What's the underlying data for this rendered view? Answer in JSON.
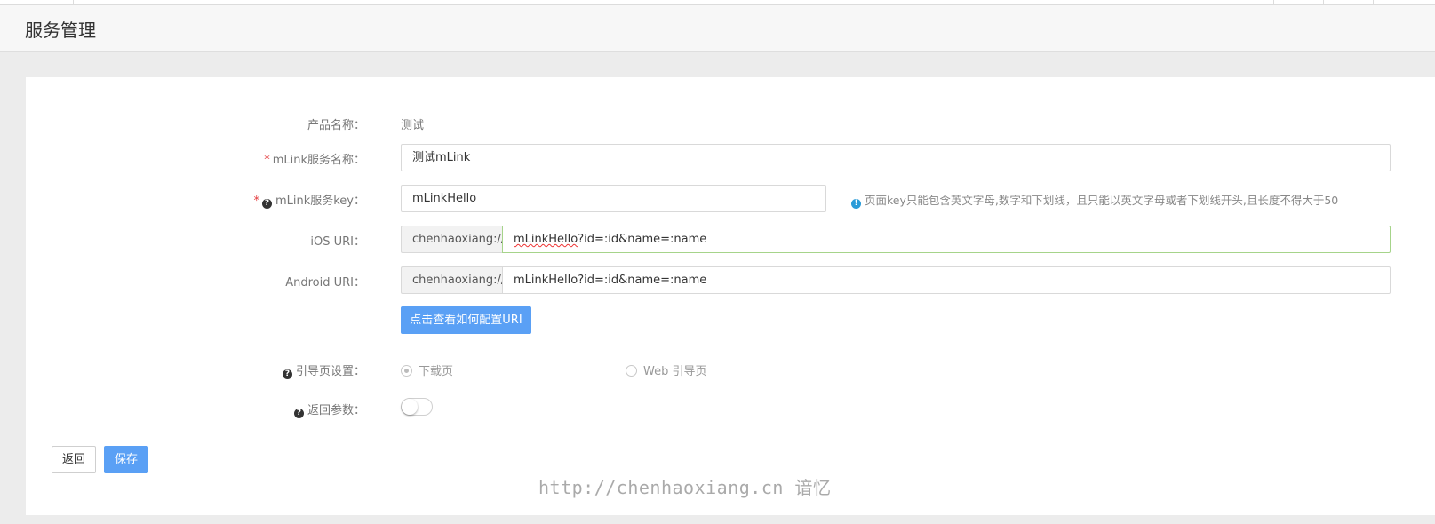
{
  "page": {
    "title": "服务管理"
  },
  "form": {
    "product_name": {
      "label": "产品名称：",
      "value": "测试"
    },
    "mlink_name": {
      "label": "mLink服务名称：",
      "required": "*",
      "value": "测试mLink"
    },
    "mlink_key": {
      "label": "mLink服务key：",
      "required": "*",
      "value": "mLinkHello",
      "hint": "页面key只能包含英文字母,数字和下划线，且只能以英文字母或者下划线开头,且长度不得大于50"
    },
    "ios_uri": {
      "label": "iOS URI：",
      "prefix": "chenhaoxiang://",
      "value_main": "mLinkHello",
      "value_rest": "?id=:id&name=:name"
    },
    "android_uri": {
      "label": "Android URI：",
      "prefix": "chenhaoxiang://",
      "value": "mLinkHello?id=:id&name=:name"
    },
    "config_uri_button": "点击查看如何配置URI",
    "guide_page": {
      "label": "引导页设置：",
      "options": [
        {
          "label": "下载页",
          "checked": true
        },
        {
          "label": "Web 引导页",
          "checked": false
        }
      ]
    },
    "return_params": {
      "label": "返回参数：",
      "enabled": false
    }
  },
  "actions": {
    "back_label": "返回",
    "save_label": "保存"
  },
  "watermark": "http://chenhaoxiang.cn 谙忆",
  "colors": {
    "primary": "#5aa0f5",
    "required": "#e4393c",
    "info": "#2a9bd8",
    "focus_border": "#a6d48a"
  },
  "icons": {
    "help": "question-circle-icon",
    "info": "info-circle-icon"
  }
}
